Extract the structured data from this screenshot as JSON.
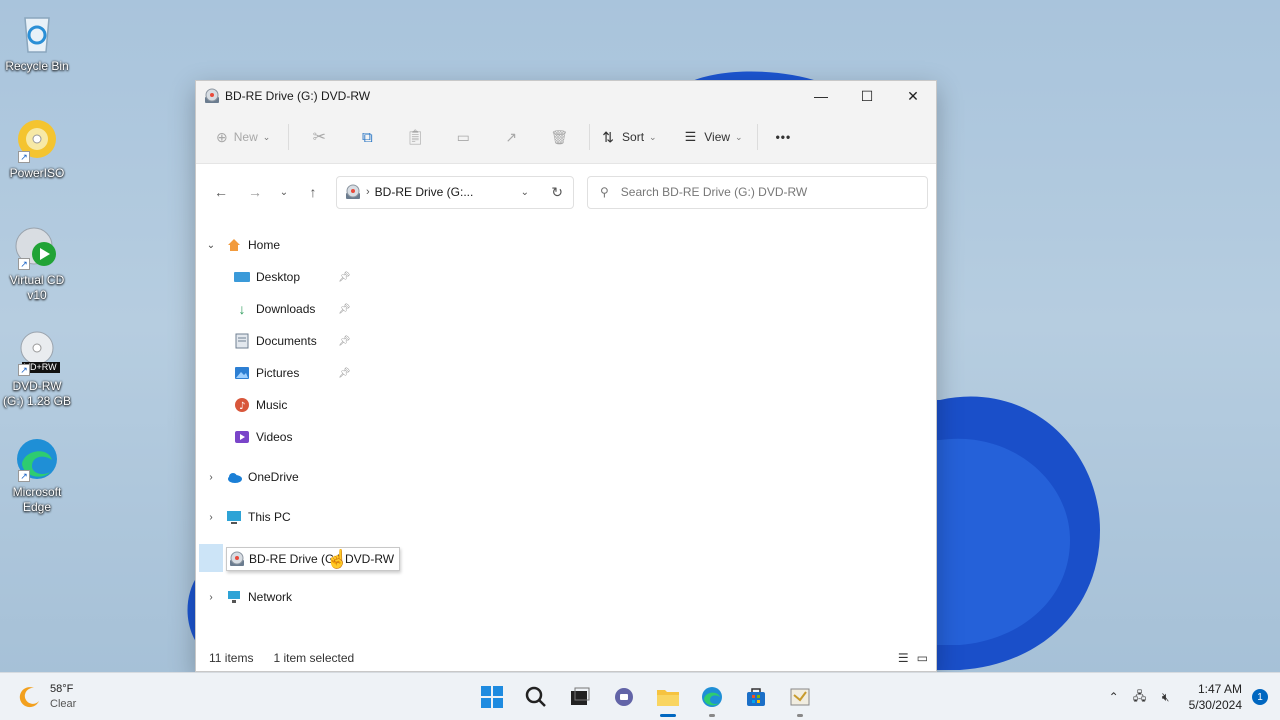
{
  "desktop": {
    "icons": [
      {
        "label": "Recycle Bin",
        "icon": "recycle-bin-icon"
      },
      {
        "label": "PowerISO",
        "icon": "poweriso-icon"
      },
      {
        "label": "Virtual CD v10",
        "icon": "virtual-cd-icon"
      },
      {
        "label": "DVD-RW (G:) 1.28 GB",
        "icon": "dvd-drive-icon"
      },
      {
        "label": "Microsoft Edge",
        "icon": "edge-icon"
      }
    ],
    "dvd_badge": "VD+RW"
  },
  "window": {
    "title": "BD-RE Drive (G:) DVD-RW",
    "controls": {
      "minimize": "—",
      "maximize": "☐",
      "close": "✕"
    },
    "commandbar": {
      "new_label": "New",
      "sort_label": "Sort",
      "view_label": "View",
      "more_label": "•••"
    },
    "address": {
      "crumb": "BD-RE Drive (G:..."
    },
    "search": {
      "placeholder": "Search BD-RE Drive (G:) DVD-RW"
    },
    "tree": {
      "home": "Home",
      "quick_access": [
        {
          "label": "Desktop",
          "pinned": true,
          "color": "#3b9ad9"
        },
        {
          "label": "Downloads",
          "pinned": true,
          "color": "#2b9b5a"
        },
        {
          "label": "Documents",
          "pinned": true,
          "color": "#6f7f91"
        },
        {
          "label": "Pictures",
          "pinned": true,
          "color": "#2d7fd3"
        },
        {
          "label": "Music",
          "pinned": false,
          "color": "#d8573b"
        },
        {
          "label": "Videos",
          "pinned": false,
          "color": "#7a45c9"
        }
      ],
      "onedrive": "OneDrive",
      "this_pc": "This PC",
      "drive_tooltip": "BD-RE Drive (G:) DVD-RW",
      "network": "Network"
    },
    "status": {
      "count": "11 items",
      "selection": "1 item selected"
    }
  },
  "taskbar": {
    "weather_temp": "58°F",
    "weather_cond": "Clear",
    "time": "1:47 AM",
    "date": "5/30/2024",
    "notification_count": "1",
    "accent": "#0067c0"
  }
}
